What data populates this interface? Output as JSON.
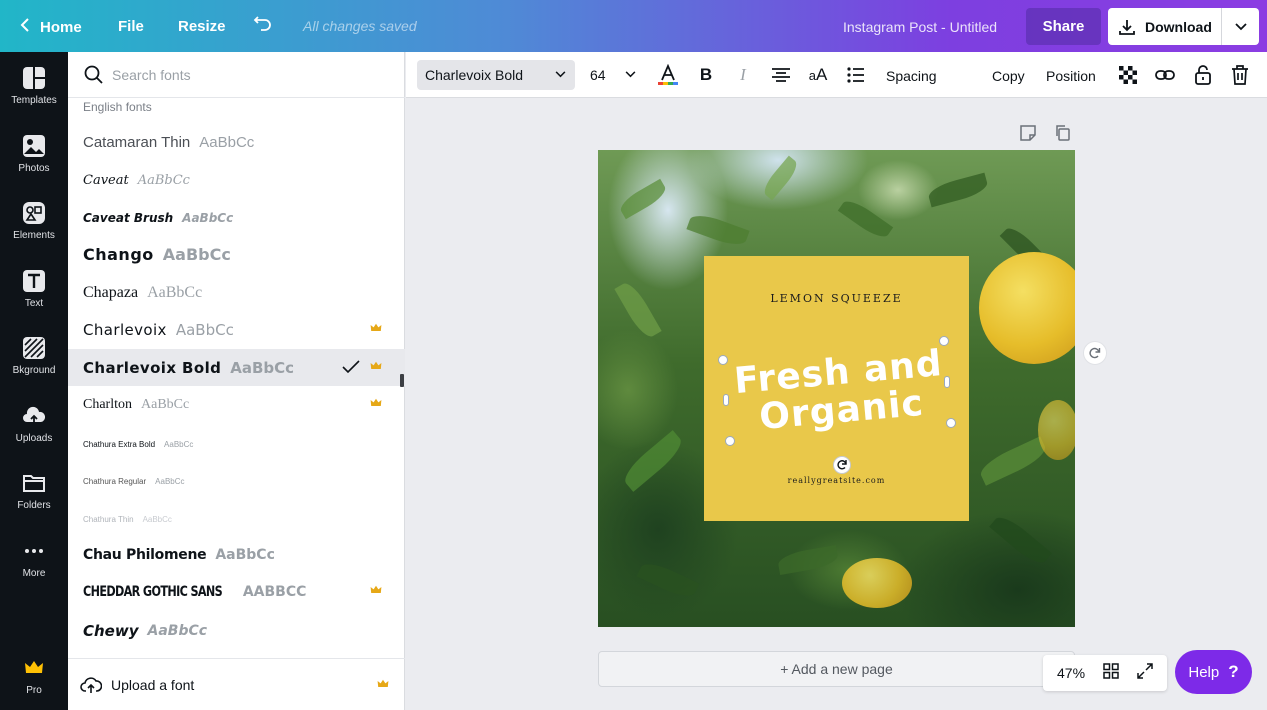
{
  "topbar": {
    "home_label": "Home",
    "file_label": "File",
    "resize_label": "Resize",
    "save_status": "All changes saved",
    "doc_title": "Instagram Post - Untitled",
    "share_label": "Share",
    "download_label": "Download",
    "gradient_colors": [
      "#21b6c8",
      "#7d3fe0"
    ]
  },
  "rail": {
    "items": [
      {
        "label": "Templates",
        "icon": "templates-icon"
      },
      {
        "label": "Photos",
        "icon": "photos-icon"
      },
      {
        "label": "Elements",
        "icon": "elements-icon"
      },
      {
        "label": "Text",
        "icon": "text-icon"
      },
      {
        "label": "Bkground",
        "icon": "background-icon"
      },
      {
        "label": "Uploads",
        "icon": "uploads-icon"
      },
      {
        "label": "Folders",
        "icon": "folders-icon"
      },
      {
        "label": "More",
        "icon": "more-icon"
      }
    ],
    "pro_label": "Pro"
  },
  "font_panel": {
    "search_placeholder": "Search fonts",
    "section_label": "English fonts",
    "sample_text": "AaBbCc",
    "fonts": [
      {
        "name": "Catamaran Thin",
        "pro": false,
        "selected": false
      },
      {
        "name": "Caveat",
        "pro": false,
        "selected": false
      },
      {
        "name": "Caveat Brush",
        "pro": false,
        "selected": false
      },
      {
        "name": "Chango",
        "pro": false,
        "selected": false
      },
      {
        "name": "Chapaza",
        "pro": false,
        "selected": false
      },
      {
        "name": "Charlevoix",
        "pro": true,
        "selected": false
      },
      {
        "name": "Charlevoix Bold",
        "pro": true,
        "selected": true
      },
      {
        "name": "Charlton",
        "pro": true,
        "selected": false
      },
      {
        "name": "Chathura Extra Bold",
        "pro": false,
        "selected": false
      },
      {
        "name": "Chathura Regular",
        "pro": false,
        "selected": false
      },
      {
        "name": "Chathura Thin",
        "pro": false,
        "selected": false
      },
      {
        "name": "Chau Philomene",
        "pro": false,
        "selected": false
      },
      {
        "name": "CHEDDAR GOTHIC SANS",
        "pro": true,
        "selected": false
      },
      {
        "name": "Chewy",
        "pro": false,
        "selected": false
      }
    ],
    "upload_label": "Upload a font"
  },
  "toolbar": {
    "font_name": "Charlevoix Bold",
    "font_size": "64",
    "text_color": "#0e1318",
    "spacing_label": "Spacing",
    "copy_label": "Copy",
    "position_label": "Position"
  },
  "design": {
    "kicker": "LEMON SQUEEZE",
    "headline_line1": "Fresh and",
    "headline_line2": "Organic",
    "url": "reallygreatsite.com",
    "card_color": "#e9c84a"
  },
  "footer": {
    "add_page_label": "+ Add a new page",
    "zoom": "47%",
    "help_label": "Help"
  }
}
